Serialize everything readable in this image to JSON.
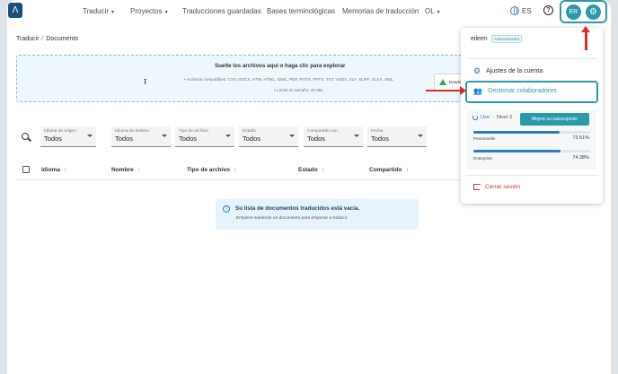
{
  "nav": {
    "logo": "Λ",
    "items": [
      {
        "label": "Traducir",
        "has_menu": true
      },
      {
        "label": "Proyectos",
        "has_menu": true
      },
      {
        "label": "Traducciones guardadas",
        "has_menu": false
      },
      {
        "label": "Bases terminológicas",
        "has_menu": false
      },
      {
        "label": "Memorias de traducción",
        "has_menu": false
      },
      {
        "label": "OL",
        "has_menu": true
      }
    ],
    "language": "ES",
    "help": "?",
    "user_initials": "ER"
  },
  "breadcrumb": {
    "parent": "Traducir",
    "separator": "/",
    "current": "Documento"
  },
  "upload": {
    "title": "Suelte los archivos aquí o haga clic para explorar",
    "formats": "Archivos compatibles: CSV, DOCX, HTM, HTML, IDML, PDF, POTX, PPTX, TXT, VSDX, XLF, XLIFF, XLSX, XML,",
    "limit": "Límite de tamaño: 20 MB.",
    "drive_button": "Desde G"
  },
  "filters": [
    {
      "label": "Idioma de origen",
      "value": "Todos"
    },
    {
      "label": "Idioma de destino",
      "value": "Todos"
    },
    {
      "label": "Tipo de archivo",
      "value": "Todos"
    },
    {
      "label": "Estado",
      "value": "Todos"
    },
    {
      "label": "Compartido con",
      "value": "Todos"
    },
    {
      "label": "Fecha",
      "value": "Todos"
    }
  ],
  "table": {
    "columns": [
      "Idioma",
      "Nombre",
      "Tipo de archivo",
      "Estado",
      "Compartido"
    ],
    "sort_arrow": "↑"
  },
  "empty": {
    "icon": "i",
    "title": "Su lista de documentos traducidos está vacía.",
    "subtitle": "Empiece subiendo un documento para empezar a traducir."
  },
  "menu": {
    "username": "eileen",
    "role": "Administrador",
    "account_settings": "Ajustes de la cuenta",
    "manage_collaborators": "Gestionar colaboradores",
    "usage_label": "Uso",
    "usage_sep": "·",
    "level": "Nivel 3",
    "upgrade": "Mejore su subscripción",
    "plans": [
      {
        "name": "Personnelle",
        "percent_text": "73.51%",
        "percent": 73.51
      },
      {
        "name": "Enterprise",
        "percent_text": "74.38%",
        "percent": 74.38
      }
    ],
    "logout": "Cerrar sesión"
  },
  "colors": {
    "accent": "#2a9aa9",
    "annotation": "#d62c2c",
    "logout": "#c0392b"
  }
}
